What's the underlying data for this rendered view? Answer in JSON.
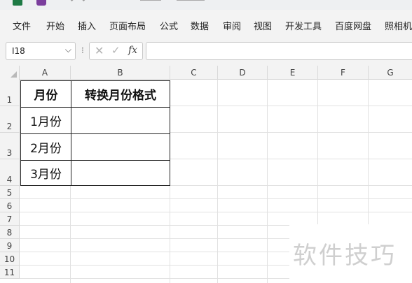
{
  "menu": {
    "items": [
      "文件",
      "开始",
      "插入",
      "页面布局",
      "公式",
      "数据",
      "审阅",
      "视图",
      "开发工具",
      "百度网盘",
      "照相机"
    ]
  },
  "formula_bar": {
    "name_box": "I18",
    "fx_label": "fx",
    "cancel_glyph": "✕",
    "enter_glyph": "✓",
    "formula_value": ""
  },
  "sheet": {
    "columns": [
      "A",
      "B",
      "C",
      "D",
      "E",
      "F",
      "G"
    ],
    "rows": [
      "1",
      "2",
      "3",
      "4",
      "5",
      "6",
      "7",
      "8",
      "9",
      "10",
      "11"
    ]
  },
  "table": {
    "headers": [
      "月份",
      "转换月份格式"
    ],
    "months": [
      "1月份",
      "2月份",
      "3月份"
    ]
  },
  "watermark": {
    "text": "软件技巧"
  },
  "colors": {
    "excel_green": "#1d7a45",
    "powerpoint_purple": "#7a3e9d"
  }
}
